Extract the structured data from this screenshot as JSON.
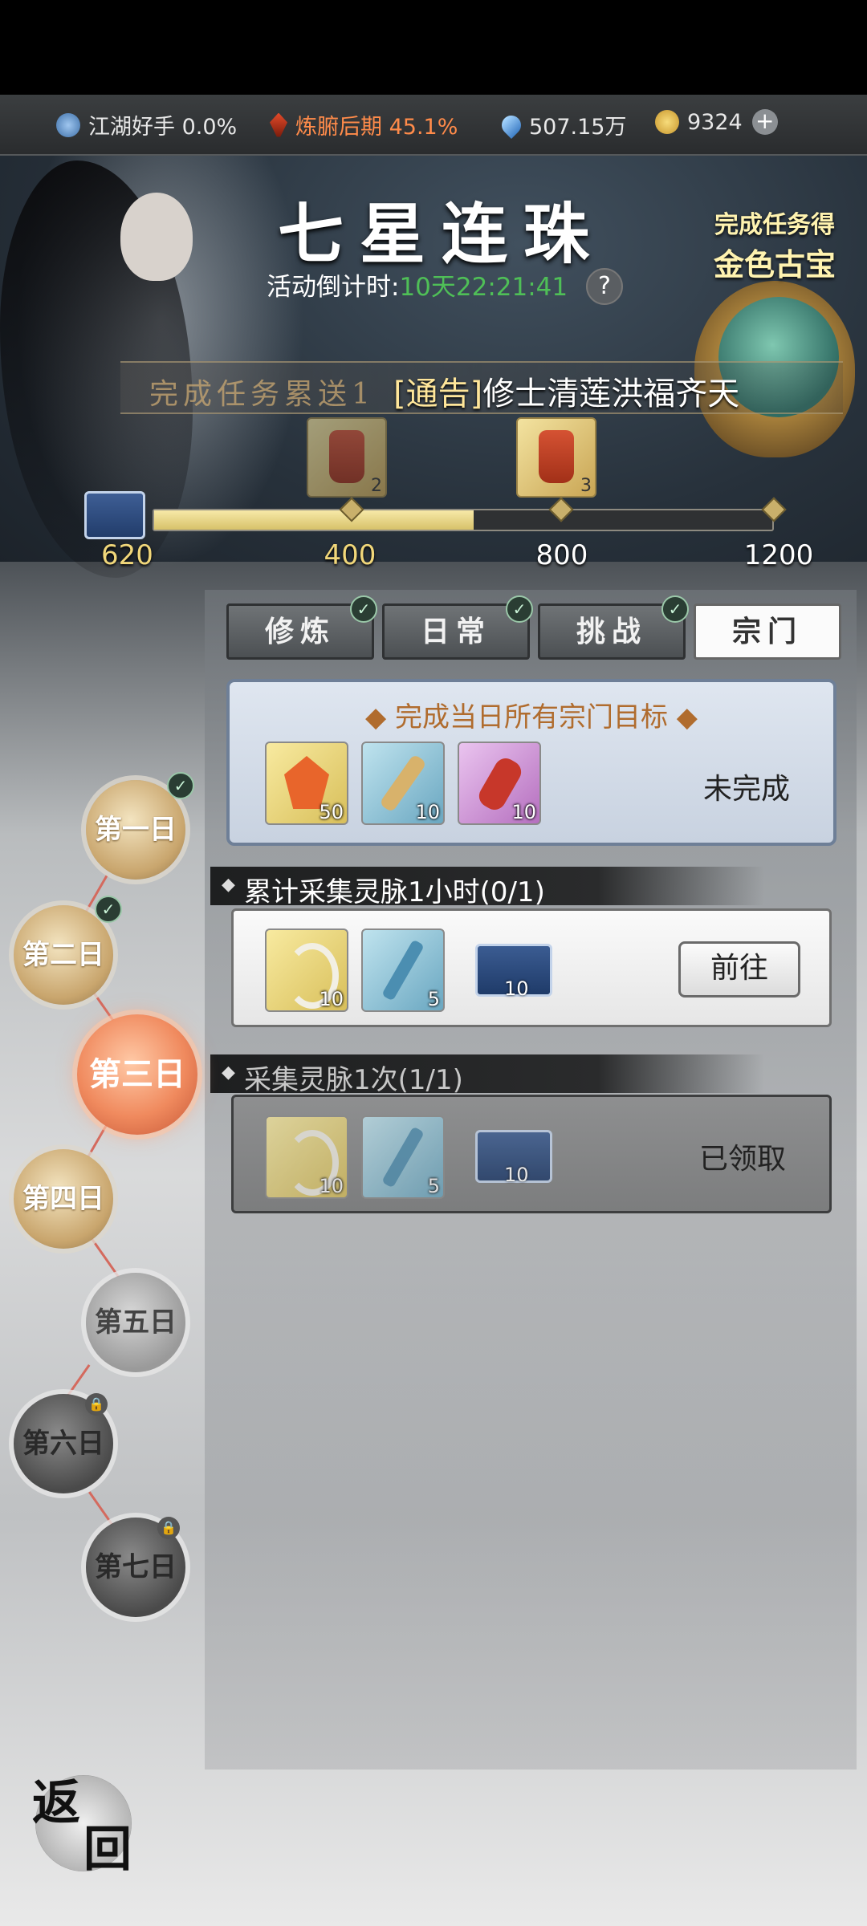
{
  "status_bar": {
    "rank_label": "江湖好手 0.0%",
    "realm_label": "炼腑后期 45.1%",
    "spirit_stones": "507.15万",
    "currency": "9324"
  },
  "event": {
    "title": "七星连珠",
    "countdown_label": "活动倒计时:",
    "countdown_value": "10天22:21:41",
    "help": "?",
    "reward_line1": "完成任务得",
    "reward_line2": "金色古宝",
    "banner_text": "完成任务累送1",
    "notice_tag": "[通告]",
    "notice_text": "修士清莲洪福齐天"
  },
  "progress": {
    "current": "620",
    "max": 1200,
    "current_value": 620,
    "milestones": [
      {
        "label": "400",
        "value": 400,
        "reward_count": "2",
        "reached": true
      },
      {
        "label": "800",
        "value": 800,
        "reward_count": "3",
        "reached": false
      },
      {
        "label": "1200",
        "value": 1200,
        "reached": false
      }
    ]
  },
  "tabs": [
    {
      "label": "修炼",
      "checked": true
    },
    {
      "label": "日常",
      "checked": true
    },
    {
      "label": "挑战",
      "checked": true
    },
    {
      "label": "宗门",
      "active": true
    }
  ],
  "goal": {
    "title": "◆ 完成当日所有宗门目标 ◆",
    "status": "未完成",
    "rewards": [
      {
        "icon": "fire-crystal-icon",
        "count": "50"
      },
      {
        "icon": "scroll-icon",
        "count": "10"
      },
      {
        "icon": "red-pouch-icon",
        "count": "10"
      }
    ]
  },
  "tasks": [
    {
      "title": "累计采集灵脉1小时(0/1)",
      "action": "前往",
      "rewards": [
        {
          "icon": "jade-hook-icon",
          "count": "10"
        },
        {
          "icon": "blue-key-icon",
          "count": "5"
        },
        {
          "icon": "book-icon",
          "count": "10"
        }
      ]
    },
    {
      "title": "采集灵脉1次(1/1)",
      "action": "已领取",
      "rewards": [
        {
          "icon": "jade-hook-icon",
          "count": "10"
        },
        {
          "icon": "blue-key-icon",
          "count": "5"
        },
        {
          "icon": "book-icon",
          "count": "10"
        }
      ]
    }
  ],
  "days": [
    "第一日",
    "第二日",
    "第三日",
    "第四日",
    "第五日",
    "第六日",
    "第七日"
  ],
  "back_button": {
    "char1": "返",
    "char2": "回"
  }
}
